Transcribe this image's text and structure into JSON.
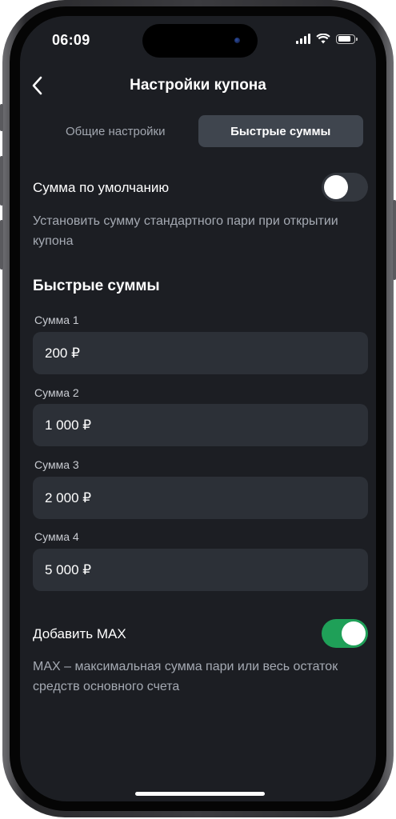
{
  "status_bar": {
    "time": "06:09"
  },
  "header": {
    "title": "Настройки купона"
  },
  "tabs": [
    {
      "label": "Общие настройки",
      "active": false
    },
    {
      "label": "Быстрые суммы",
      "active": true
    }
  ],
  "default_amount": {
    "label": "Сумма по умолчанию",
    "enabled": false,
    "description": "Установить сумму стандартного пари при открытии купона"
  },
  "quick_amounts": {
    "title": "Быстрые суммы",
    "fields": [
      {
        "label": "Сумма 1",
        "value": "200 ₽"
      },
      {
        "label": "Сумма 2",
        "value": "1 000 ₽"
      },
      {
        "label": "Сумма 3",
        "value": "2 000 ₽"
      },
      {
        "label": "Сумма 4",
        "value": "5 000 ₽"
      }
    ]
  },
  "add_max": {
    "label": "Добавить MAX",
    "enabled": true,
    "description": "MAX – максимальная сумма пари или весь остаток средств основного счета"
  },
  "colors": {
    "background": "#1c1e23",
    "field": "#2c3037",
    "toggle_on": "#1fa058",
    "toggle_off": "#33373e"
  }
}
